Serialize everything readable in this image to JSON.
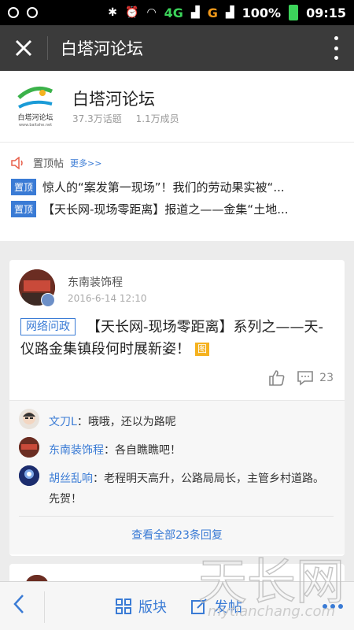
{
  "status_bar": {
    "network": "4G",
    "carrier": "G",
    "battery": "100%",
    "time": "09:15"
  },
  "title_bar": {
    "title": "白塔河论坛"
  },
  "forum": {
    "name": "白塔河论坛",
    "topics": "37.3万话题",
    "members": "1.1万成员",
    "logo_text": "白塔河论坛",
    "logo_url_text": "www.baitahe.net"
  },
  "pinned": {
    "label": "置顶帖",
    "more": "更多>>",
    "badge": "置顶",
    "items": [
      {
        "title": "惊人的“案发第一现场”！我们的劳动果实被“..."
      },
      {
        "title": "【天长网-现场零距离】报道之——金集“土地..."
      }
    ]
  },
  "post": {
    "author": "东南装饰程",
    "time": "2016-6-14 12:10",
    "tag": "网络问政",
    "title": "【天长网-现场零距离】系列之——天-仪路金集镇段何时展新姿！",
    "image_badge": "图",
    "comment_count": "23",
    "comments": [
      {
        "author": "文刀L",
        "text": "哦哦，还以为路呢"
      },
      {
        "author": "东南装饰程",
        "text": "各自瞧瞧吧！"
      },
      {
        "author": "胡丝乱响",
        "text": "老程明天高升，公路局局长，主管乡村道路。先贺！"
      }
    ],
    "view_all": "查看全部23条回复"
  },
  "bottom_bar": {
    "sections": "版块",
    "post": "发帖"
  },
  "watermark": {
    "text": "天长网",
    "url": "mytianchang.com"
  },
  "colors": {
    "accent": "#3a7bd5",
    "title_bar": "#3b3b3b",
    "image_badge": "#f5b21f"
  }
}
